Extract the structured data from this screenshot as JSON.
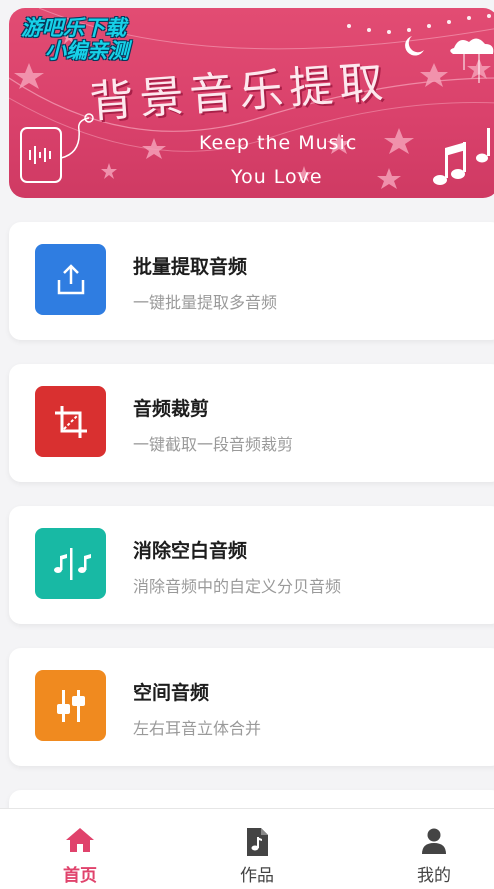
{
  "banner": {
    "watermark_line1": "游吧乐下载",
    "watermark_line2": "小编亲测",
    "title": "背景音乐提取",
    "subtitle_line1": "Keep the Music",
    "subtitle_line2": "You Love"
  },
  "features": [
    {
      "title": "批量提取音频",
      "desc": "一键批量提取多音频",
      "color": "#2f7de1",
      "icon": "upload-icon"
    },
    {
      "title": "音频裁剪",
      "desc": "一键截取一段音频裁剪",
      "color": "#d93030",
      "icon": "crop-icon"
    },
    {
      "title": "消除空白音频",
      "desc": "消除音频中的自定义分贝音频",
      "color": "#18b9a4",
      "icon": "split-notes-icon"
    },
    {
      "title": "空间音频",
      "desc": "左右耳音立体合并",
      "color": "#f08a1f",
      "icon": "equalizer-icon"
    }
  ],
  "tabbar": {
    "home": "首页",
    "works": "作品",
    "mine": "我的",
    "active_color": "#e0436c"
  }
}
